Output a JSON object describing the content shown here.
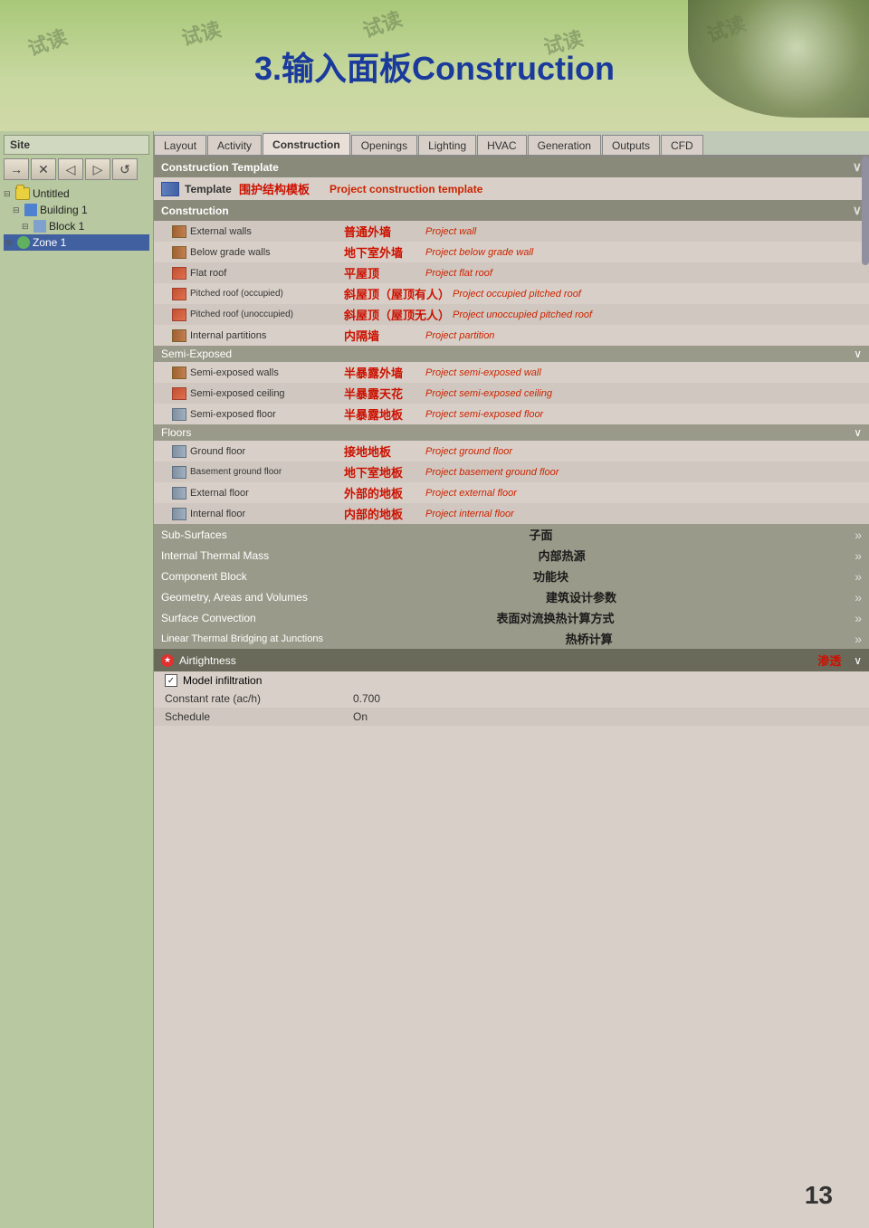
{
  "header": {
    "title": "3.输入面板Construction"
  },
  "watermarks": [
    "试读",
    "试读",
    "试读",
    "试读",
    "试读",
    "试读"
  ],
  "sidebar": {
    "site_label": "Site",
    "toolbar_buttons": [
      "→",
      "✕",
      "◁",
      "▷",
      "↺"
    ],
    "tree": [
      {
        "label": "Untitled",
        "indent": 0,
        "type": "folder",
        "expand": "⊟"
      },
      {
        "label": "Building 1",
        "indent": 1,
        "type": "building",
        "expand": "⊟"
      },
      {
        "label": "Block 1",
        "indent": 2,
        "type": "block",
        "expand": "⊟"
      },
      {
        "label": "Zone 1",
        "indent": 3,
        "type": "zone",
        "expand": "⊞"
      }
    ]
  },
  "tabs": [
    {
      "label": "Layout"
    },
    {
      "label": "Activity"
    },
    {
      "label": "Construction",
      "active": true
    },
    {
      "label": "Openings"
    },
    {
      "label": "Lighting"
    },
    {
      "label": "HVAC"
    },
    {
      "label": "Generation"
    },
    {
      "label": "Outputs"
    },
    {
      "label": "CFD"
    }
  ],
  "sections": {
    "construction_template": {
      "header": "Construction Template",
      "template_row": {
        "label_en": "Template",
        "label_cn": "围护结构模板",
        "value": "Project construction template"
      }
    },
    "construction": {
      "header": "Construction",
      "rows": [
        {
          "label_en": "External walls",
          "label_cn": "普通外墙",
          "value": "Project wall",
          "icon": "wall"
        },
        {
          "label_en": "Below grade walls",
          "label_cn": "地下室外墙",
          "value": "Project below grade wall",
          "icon": "wall"
        },
        {
          "label_en": "Flat roof",
          "label_cn": "平屋顶",
          "value": "Project flat roof",
          "icon": "roof"
        },
        {
          "label_en": "Pitched roof (occupied)",
          "label_cn": "斜屋顶（屋顶有人）",
          "value": "Project occupied pitched roof",
          "icon": "roof"
        },
        {
          "label_en": "Pitched roof (unoccupied)",
          "label_cn": "斜屋顶（屋顶无人）",
          "value": "Project unoccupied pitched roof",
          "icon": "roof"
        },
        {
          "label_en": "Internal partitions",
          "label_cn": "内隔墙",
          "value": "Project partition",
          "icon": "wall"
        }
      ]
    },
    "semi_exposed": {
      "header": "Semi-Exposed",
      "rows": [
        {
          "label_en": "Semi-exposed walls",
          "label_cn": "半暴露外墙",
          "value": "Project semi-exposed wall",
          "icon": "wall"
        },
        {
          "label_en": "Semi-exposed ceiling",
          "label_cn": "半暴露天花",
          "value": "Project semi-exposed ceiling",
          "icon": "roof"
        },
        {
          "label_en": "Semi-exposed floor",
          "label_cn": "半暴露地板",
          "value": "Project semi-exposed floor",
          "icon": "floor"
        }
      ]
    },
    "floors": {
      "header": "Floors",
      "rows": [
        {
          "label_en": "Ground floor",
          "label_cn": "接地地板",
          "value": "Project ground floor",
          "icon": "floor"
        },
        {
          "label_en": "Basement ground floor",
          "label_cn": "地下室地板",
          "value": "Project basement ground floor",
          "icon": "floor"
        },
        {
          "label_en": "External floor",
          "label_cn": "外部的地板",
          "value": "Project external floor",
          "icon": "floor"
        },
        {
          "label_en": "Internal floor",
          "label_cn": "内部的地板",
          "value": "Project internal floor",
          "icon": "floor"
        }
      ]
    },
    "bottom_sections": [
      {
        "label_en": "Sub-Surfaces",
        "label_cn": "子面",
        "arrow": "»"
      },
      {
        "label_en": "Internal Thermal Mass",
        "label_cn": "内部热源",
        "arrow": "»"
      },
      {
        "label_en": "Component Block",
        "label_cn": "功能块",
        "arrow": "»"
      },
      {
        "label_en": "Geometry, Areas and Volumes",
        "label_cn": "建筑设计参数",
        "arrow": "»"
      },
      {
        "label_en": "Surface Convection",
        "label_cn": "表面对流换热计算方式",
        "arrow": "»"
      },
      {
        "label_en": "Linear Thermal Bridging at Junctions",
        "label_cn": "热桥计算",
        "arrow": "»"
      }
    ],
    "airtightness": {
      "header": "Airtightness",
      "header_cn": "渗透",
      "model_infiltration": {
        "label": "Model infiltration",
        "checked": true
      },
      "constant_rate": {
        "label": "Constant rate (ac/h)",
        "value": "0.700"
      },
      "schedule": {
        "label": "Schedule",
        "value": "On"
      }
    }
  },
  "page_number": "13"
}
